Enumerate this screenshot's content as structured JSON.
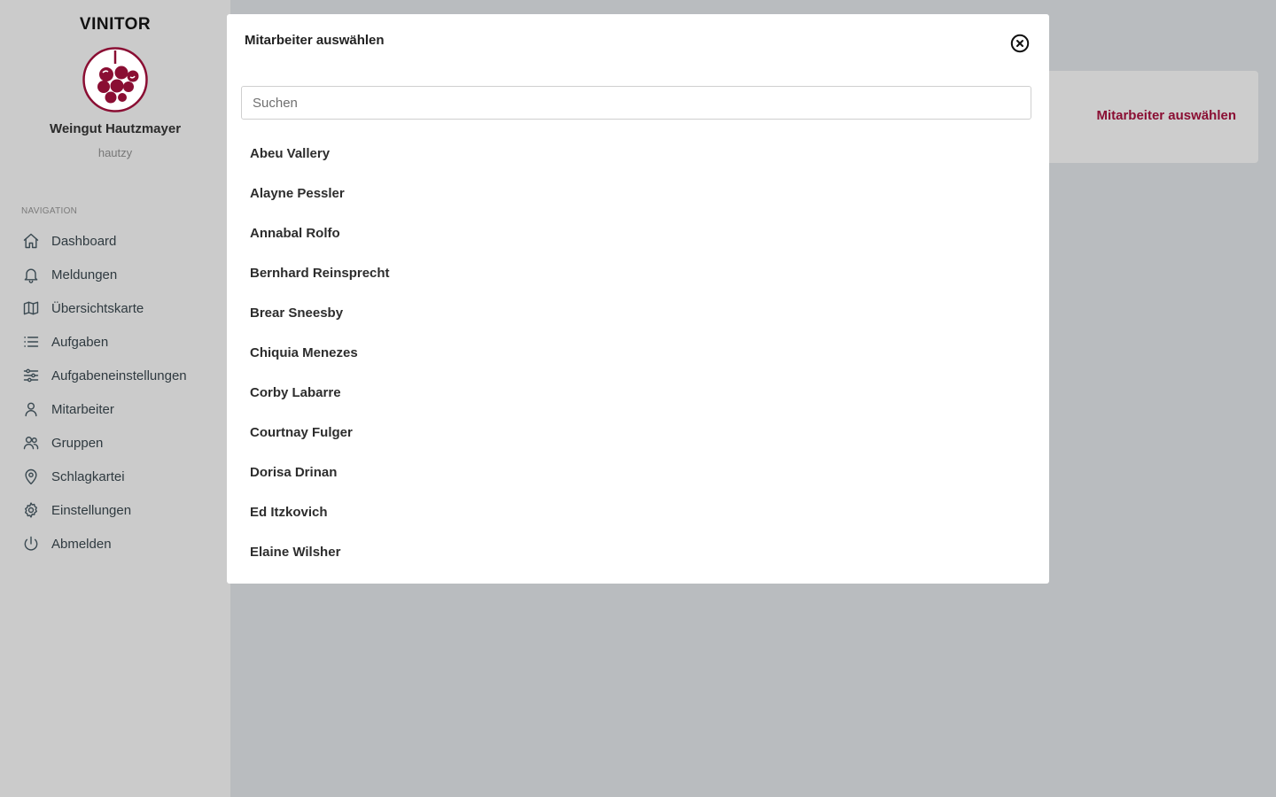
{
  "sidebar": {
    "brand": "VINITOR",
    "logo_icon": "grape-logo-icon",
    "company": "Weingut Hautzmayer",
    "username": "hautzy",
    "nav_heading": "NAVIGATION",
    "items": [
      {
        "label": "Dashboard",
        "icon": "home-icon"
      },
      {
        "label": "Meldungen",
        "icon": "bell-icon"
      },
      {
        "label": "Übersichtskarte",
        "icon": "map-icon"
      },
      {
        "label": "Aufgaben",
        "icon": "list-icon"
      },
      {
        "label": "Aufgabeneinstellungen",
        "icon": "sliders-icon"
      },
      {
        "label": "Mitarbeiter",
        "icon": "user-icon"
      },
      {
        "label": "Gruppen",
        "icon": "users-icon"
      },
      {
        "label": "Schlagkartei",
        "icon": "map-pin-icon"
      },
      {
        "label": "Einstellungen",
        "icon": "gear-icon"
      },
      {
        "label": "Abmelden",
        "icon": "power-icon"
      }
    ]
  },
  "background": {
    "select_link": "Mitarbeiter auswählen"
  },
  "modal": {
    "title": "Mitarbeiter auswählen",
    "search_placeholder": "Suchen",
    "employees": [
      "Abeu Vallery",
      "Alayne Pessler",
      "Annabal Rolfo",
      "Bernhard Reinsprecht",
      "Brear Sneesby",
      "Chiquia Menezes",
      "Corby Labarre",
      "Courtnay Fulger",
      "Dorisa Drinan",
      "Ed Itzkovich",
      "Elaine Wilsher"
    ]
  },
  "colors": {
    "accent": "#8a0e33",
    "sidebar_bg": "#cbcbcb",
    "overlay_bg": "#b9bcbf"
  }
}
